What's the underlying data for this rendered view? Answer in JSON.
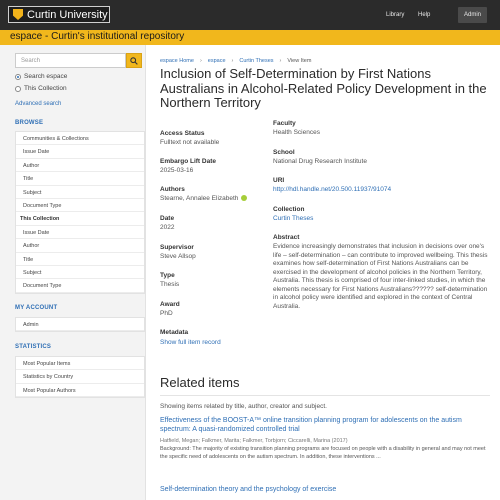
{
  "header": {
    "logo_text": "Curtin University",
    "nav": {
      "library": "Library",
      "help": "Help",
      "admin": "Admin"
    }
  },
  "banner": {
    "title": "espace - Curtin's institutional repository"
  },
  "sidebar": {
    "search_placeholder": "Search",
    "scope_options": [
      "Search espace",
      "This Collection"
    ],
    "advanced_search": "Advanced search",
    "browse_heading": "BROWSE",
    "browse_items": [
      "Communities & Collections",
      "Issue Date",
      "Author",
      "Title",
      "Subject",
      "Document Type"
    ],
    "this_collection_heading": "This Collection",
    "collection_items": [
      "Issue Date",
      "Author",
      "Title",
      "Subject",
      "Document Type"
    ],
    "account_heading": "MY ACCOUNT",
    "account_items": [
      "Admin"
    ],
    "statistics_heading": "STATISTICS",
    "statistics_items": [
      "Most Popular Items",
      "Statistics by Country",
      "Most Popular Authors"
    ]
  },
  "breadcrumbs": [
    "espace Home",
    "espace",
    "Curtin Theses",
    "View Item"
  ],
  "item": {
    "title": "Inclusion of Self-Determination by First Nations Australians in Alcohol-Related Policy Development in the Northern Territory",
    "access_status_label": "Access Status",
    "access_status": "Fulltext not available",
    "embargo_label": "Embargo Lift Date",
    "embargo": "2025-03-16",
    "authors_label": "Authors",
    "author": "Stearne, Annalee Elizabeth",
    "date_label": "Date",
    "date": "2022",
    "supervisor_label": "Supervisor",
    "supervisor": "Steve Allsop",
    "type_label": "Type",
    "type": "Thesis",
    "award_label": "Award",
    "award": "PhD",
    "metadata_label": "Metadata",
    "show_full": "Show full item record",
    "faculty_label": "Faculty",
    "faculty": "Health Sciences",
    "school_label": "School",
    "school": "National Drug Research Institute",
    "uri_label": "URI",
    "uri": "http://hdl.handle.net/20.500.11937/91074",
    "collection_label": "Collection",
    "collection": "Curtin Theses",
    "abstract_label": "Abstract",
    "abstract": "Evidence increasingly demonstrates that inclusion in decisions over one's life – self-determination – can contribute to improved wellbeing. This thesis examines how self-determination of First Nations Australians can be exercised in the development of alcohol policies in the Northern Territory, Australia. This thesis is comprised of four inter-linked studies, in which the elements necessary for First Nations Australians?????? self-determination in alcohol policy were identified and explored in the context of Central Australia."
  },
  "related": {
    "heading": "Related items",
    "subheading": "Showing items related by title, author, creator and subject.",
    "items": [
      {
        "title": "Effectiveness of the BOOST-A™ online transition planning program for adolescents on the autism spectrum: A quasi-randomized controlled trial",
        "meta": "Hatfield, Megan; Falkmer, Marita; Falkmer, Torbjorn; Ciccarelli, Marina (2017)",
        "desc": "Background: The majority of existing transition planning programs are focused on people with a disability in general and may not meet the specific need of adolescents on the autism spectrum. In addition, these interventions ..."
      },
      {
        "title": "Self-determination theory and the psychology of exercise",
        "meta": "",
        "desc": ""
      }
    ]
  },
  "colors": {
    "accent_yellow": "#f1b71c",
    "link_blue": "#2f6fb5",
    "topbar": "#2b2b2b"
  }
}
